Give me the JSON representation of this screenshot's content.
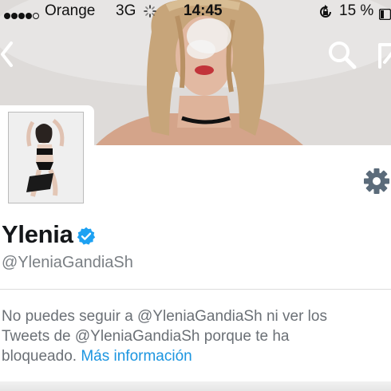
{
  "status_bar": {
    "carrier": "Orange",
    "network": "3G",
    "time": "14:45",
    "battery": "15 %",
    "signal_bars": 4,
    "signal_total": 5,
    "icons": [
      "activity-spinner-icon",
      "rotation-lock-icon",
      "battery-icon"
    ]
  },
  "nav": {
    "icons": [
      "back-chevron-icon",
      "search-icon",
      "compose-icon",
      "gear-icon"
    ]
  },
  "profile": {
    "display_name": "Ylenia",
    "handle": "@YleniaGandiaSh",
    "verified": true,
    "verified_color": "#1da1f2"
  },
  "blocked_notice": {
    "line1": "No puedes seguir a @YleniaGandiaSh ni ver los",
    "line2": "Tweets de @YleniaGandiaSh porque te ha",
    "line3_prefix": "bloqueado. ",
    "more_info_link": "Más información"
  },
  "colors": {
    "link": "#1b95e0",
    "text_secondary": "#6b7076",
    "name": "#14171a"
  }
}
